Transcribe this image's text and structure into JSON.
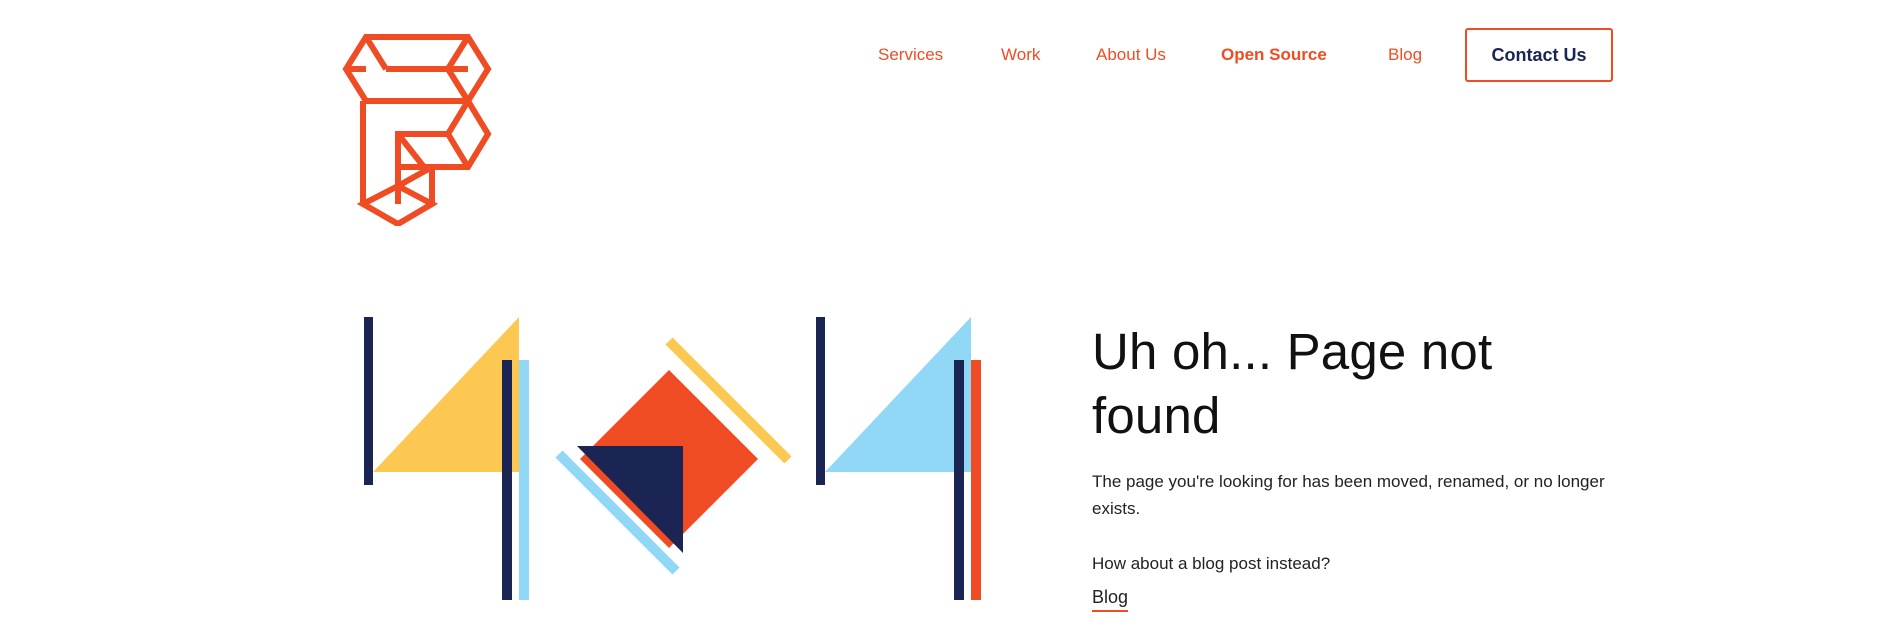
{
  "colors": {
    "accent": "#ef4c23",
    "navy": "#1b2553",
    "yellow": "#fdc852",
    "light_blue": "#91d7f6"
  },
  "logo": {
    "icon": "geometric-f-logo-icon"
  },
  "nav": {
    "items": [
      {
        "label": "Services"
      },
      {
        "label": "Work"
      },
      {
        "label": "About Us"
      },
      {
        "label": "Open Source",
        "active": true
      },
      {
        "label": "Blog"
      }
    ],
    "cta_label": "Contact Us"
  },
  "illustration": {
    "icon": "404-geometric-illustration"
  },
  "main": {
    "title": "Uh oh... Page not found",
    "description": "The page you're looking for has been moved, renamed, or no longer exists.",
    "prompt": "How about a blog post instead?",
    "link_label": "Blog"
  }
}
